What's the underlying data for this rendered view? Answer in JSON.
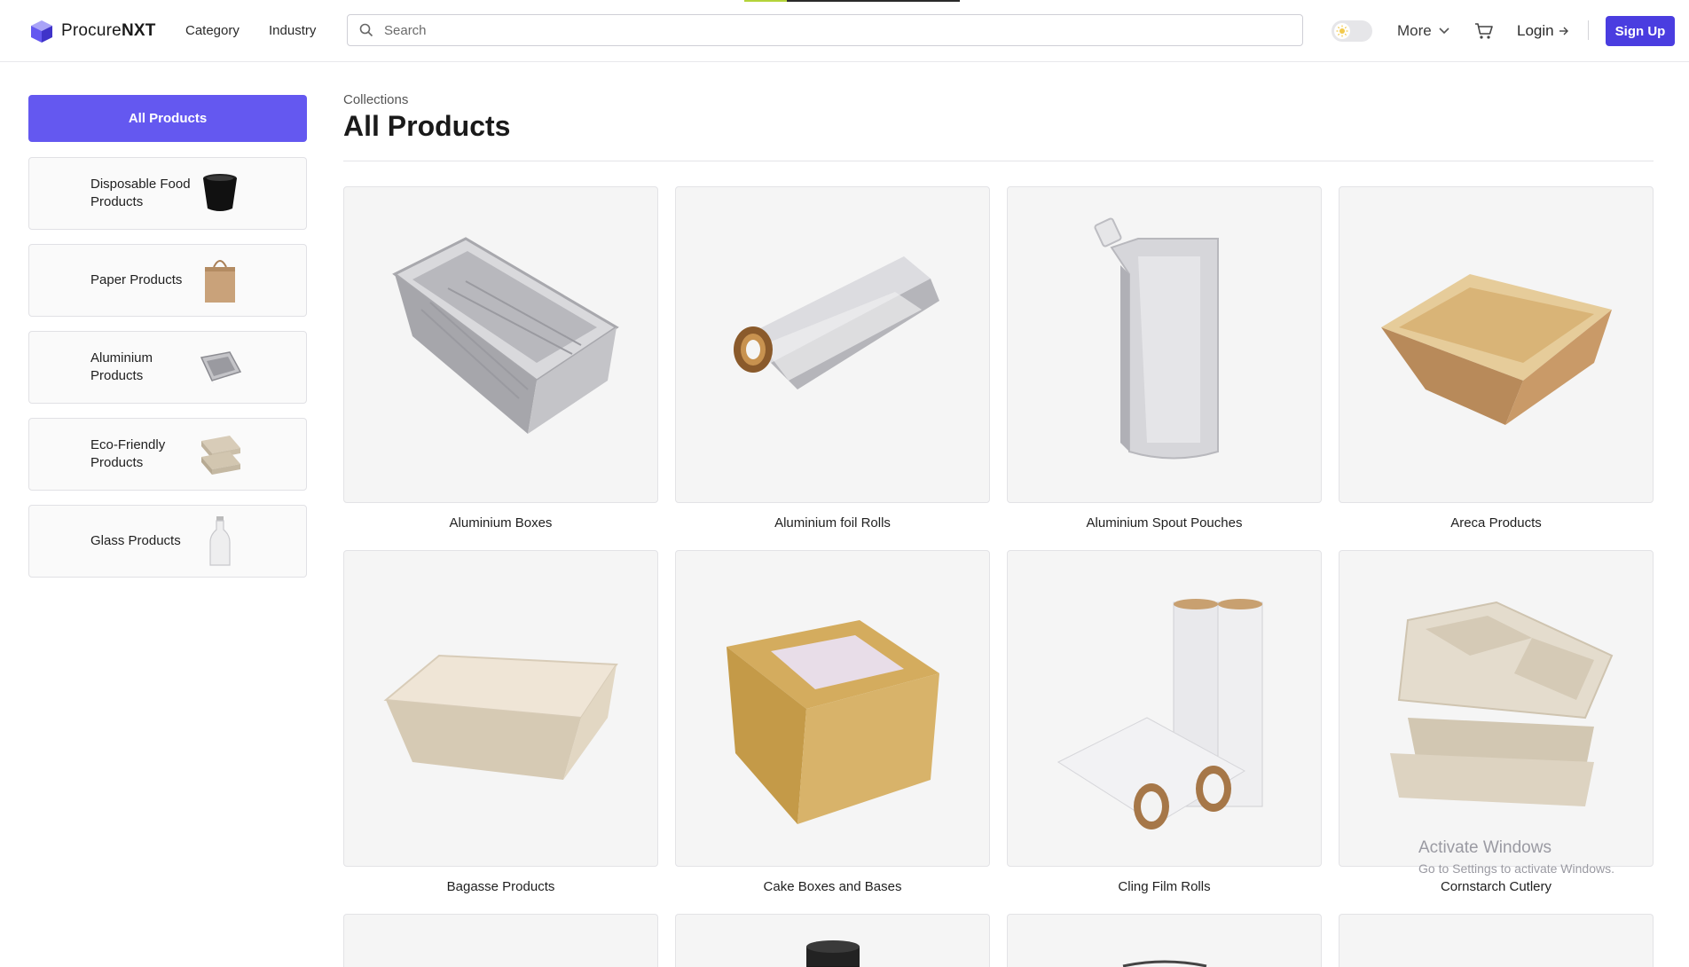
{
  "header": {
    "logo_prefix": "Procure",
    "logo_suffix": "NXT",
    "nav": [
      "Category",
      "Industry"
    ],
    "search_placeholder": "Search",
    "more_label": "More",
    "login_label": "Login",
    "signup_label": "Sign Up"
  },
  "sidebar": {
    "all_label": "All Products",
    "items": [
      {
        "label": "Disposable Food Products",
        "icon": "black-cup-icon"
      },
      {
        "label": "Paper Products",
        "icon": "paper-bag-icon"
      },
      {
        "label": "Aluminium Products",
        "icon": "aluminium-tray-icon"
      },
      {
        "label": "Eco-Friendly Products",
        "icon": "bagasse-container-icon"
      },
      {
        "label": "Glass Products",
        "icon": "glass-bottle-icon"
      }
    ]
  },
  "main": {
    "breadcrumb": "Collections",
    "title": "All Products",
    "products": [
      {
        "name": "Aluminium Boxes",
        "image": "aluminium-box"
      },
      {
        "name": "Aluminium foil Rolls",
        "image": "foil-roll"
      },
      {
        "name": "Aluminium Spout Pouches",
        "image": "spout-pouch"
      },
      {
        "name": "Areca Products",
        "image": "areca-bowl"
      },
      {
        "name": "Bagasse Products",
        "image": "bagasse-box"
      },
      {
        "name": "Cake Boxes and Bases",
        "image": "cake-box"
      },
      {
        "name": "Cling Film Rolls",
        "image": "cling-film"
      },
      {
        "name": "Cornstarch Cutlery",
        "image": "cornstarch-tray"
      }
    ]
  },
  "watermark": {
    "line1": "Activate Windows",
    "line2": "Go to Settings to activate Windows."
  },
  "colors": {
    "accent": "#6458f0",
    "signup": "#4a3de0"
  }
}
